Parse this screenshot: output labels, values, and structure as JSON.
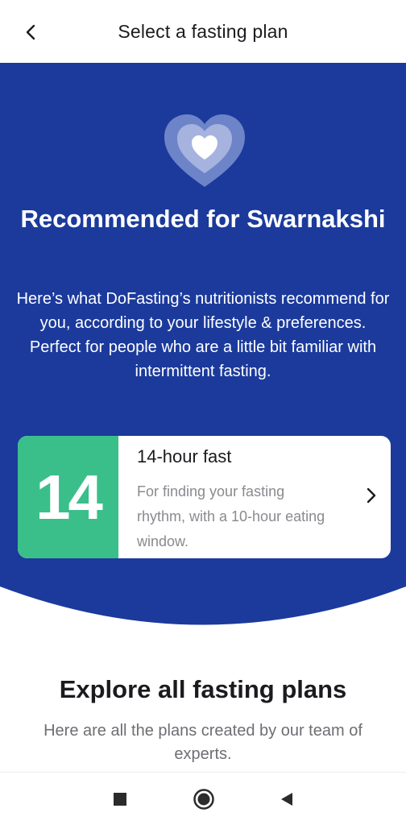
{
  "header": {
    "title": "Select a fasting plan",
    "back_icon": "chevron-left-icon"
  },
  "hero": {
    "title": "Recommended for Swarnakshi",
    "description": "Here’s what DoFasting’s nutritionists recommend for you, according to your lifestyle & preferences. Perfect for people who are a little bit familiar with intermittent fasting.",
    "icon": "heart-icon",
    "background_color": "#1b3a9c"
  },
  "plan": {
    "number": "14",
    "name": "14-hour fast",
    "description": "For finding your fasting rhythm, with a 10-hour eating window.",
    "accent_color": "#3bbf8a",
    "chevron_icon": "chevron-right-icon"
  },
  "explore": {
    "title": "Explore all fasting plans",
    "description": "Here are all the plans created by our team of experts."
  },
  "navbar": {
    "recent_icon": "square-icon",
    "home_icon": "circle-icon",
    "back_icon": "triangle-back-icon"
  }
}
